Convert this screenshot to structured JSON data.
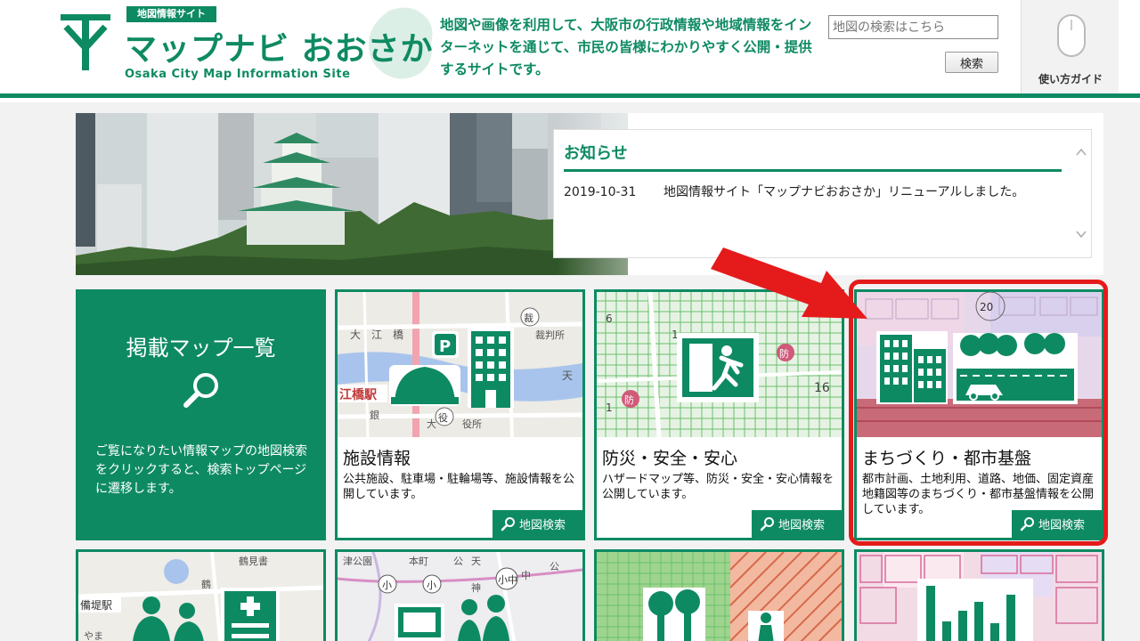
{
  "header": {
    "badge": "地図情報サイト",
    "site_name": "マップナビ おおさか",
    "site_sub": "Osaka City Map Information Site",
    "intro": "地図や画像を利用して、大阪市の行政情報や地域情報をインターネットを通じて、市民の皆様にわかりやすく公開・提供するサイトです。",
    "search_placeholder": "地図の検索はこちら",
    "search_button": "検索",
    "guide_label": "使い方ガイド"
  },
  "news": {
    "title": "お知らせ",
    "items": [
      {
        "date": "2019-10-31",
        "text": "地図情報サイト「マップナビおおさか」リニューアルしました。"
      }
    ]
  },
  "map_list": {
    "title": "掲載マップ一覧",
    "description": "ご覧になりたい情報マップの地図検索をクリックすると、検索トップページに遷移します。"
  },
  "cards": [
    {
      "title": "施設情報",
      "description": "公共施設、駐車場・駐輪場等、施設情報を公開しています。",
      "button": "地図検索"
    },
    {
      "title": "防災・安全・安心",
      "description": "ハザードマップ等、防災・安全・安心情報を公開しています。",
      "button": "地図検索"
    },
    {
      "title": "まちづくり・都市基盤",
      "description": "都市計画、土地利用、道路、地価、固定資産地籍図等のまちづくり・都市基盤情報を公開しています。",
      "button": "地図検索"
    }
  ],
  "map_labels": {
    "card1": [
      "大",
      "江",
      "橋",
      "江橋駅",
      "裁判所",
      "天",
      "大",
      "役所",
      "銀",
      "裁",
      "役"
    ],
    "card2": [
      "6",
      "16",
      "1",
      "1",
      "防",
      "防"
    ],
    "card3": [
      "20"
    ],
    "row2_card1": [
      "鶴見書",
      "備堤駅",
      "やま",
      "鶴"
    ],
    "row2_card2": [
      "津公園",
      "本町",
      "公",
      "天",
      "神",
      "中",
      "小",
      "小",
      "小中",
      "公"
    ]
  },
  "colors": {
    "brand": "#0e8a63",
    "annotation": "#e51b1b",
    "background": "#f2f2f2"
  }
}
